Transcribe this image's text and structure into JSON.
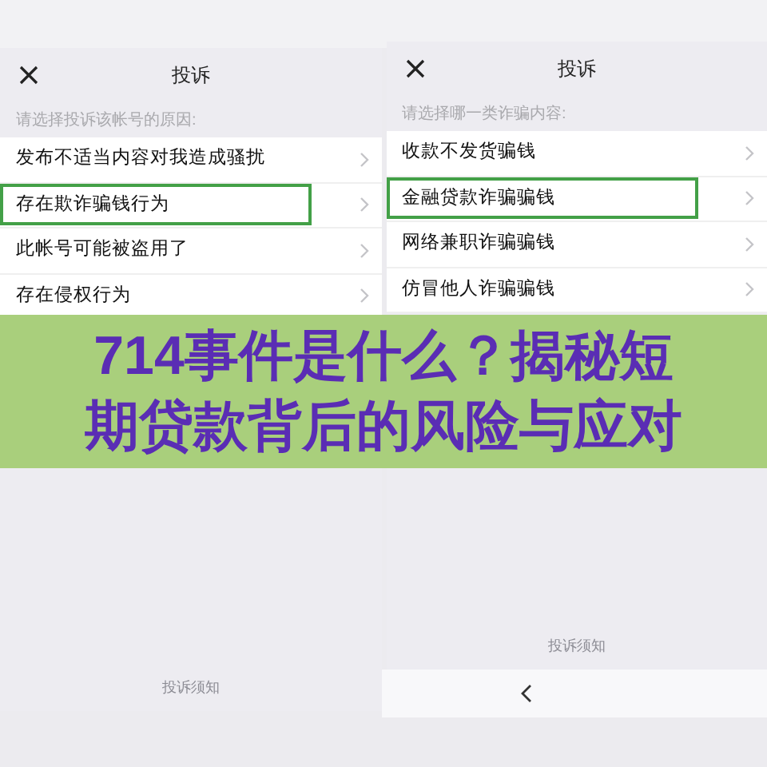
{
  "panels": [
    {
      "title": "投诉",
      "hint": "请选择投诉该帐号的原因:",
      "options": [
        {
          "label": "发布不适当内容对我造成骚扰",
          "selected": false
        },
        {
          "label": "存在欺诈骗钱行为",
          "selected": true
        },
        {
          "label": "此帐号可能被盗用了",
          "selected": false
        },
        {
          "label": "存在侵权行为",
          "selected": false
        }
      ],
      "footer_link": "投诉须知",
      "back_bar": false
    },
    {
      "title": "投诉",
      "hint": "请选择哪一类诈骗内容:",
      "options": [
        {
          "label": "收款不发货骗钱",
          "selected": false
        },
        {
          "label": "金融贷款诈骗骗钱",
          "selected": true
        },
        {
          "label": "网络兼职诈骗骗钱",
          "selected": false
        },
        {
          "label": "仿冒他人诈骗骗钱",
          "selected": false
        }
      ],
      "footer_link": "投诉须知",
      "back_bar": true
    }
  ],
  "banner": {
    "title_lines": [
      "714事件是什么？揭秘短",
      "期贷款背后的风险与应对"
    ]
  }
}
